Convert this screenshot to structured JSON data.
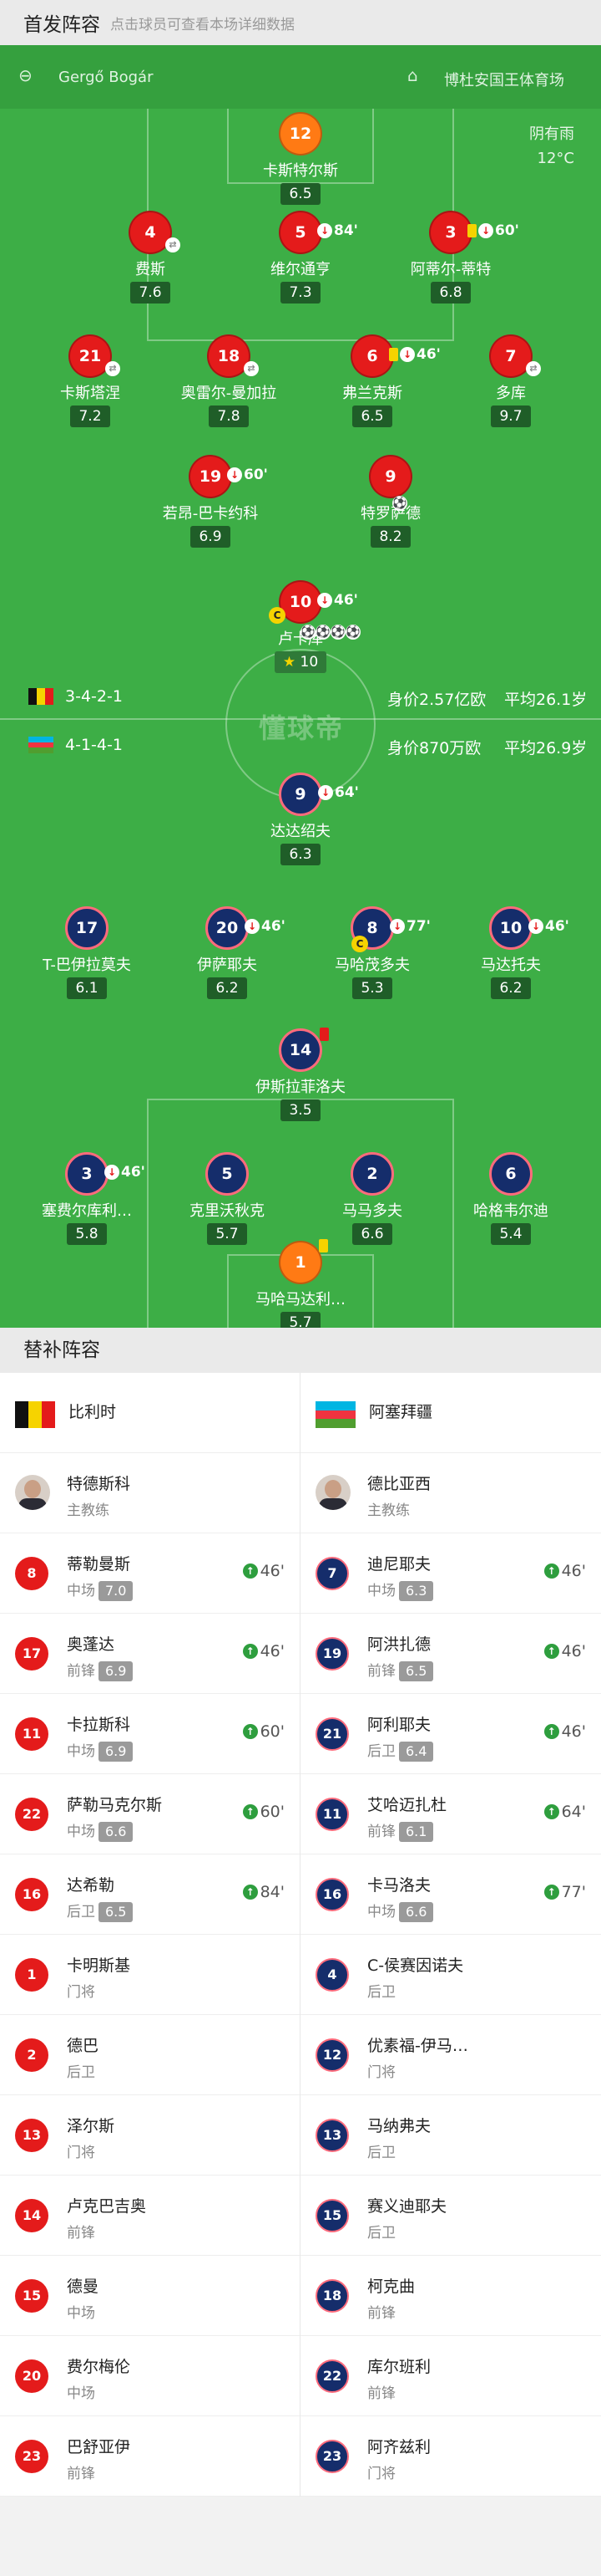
{
  "header": {
    "title": "首发阵容",
    "subtitle": "点击球员可查看本场详细数据"
  },
  "pitch": {
    "referee": "Gergő Bogár",
    "stadium": "博杜安国王体育场",
    "weather": "阴有雨",
    "temperature": "12°C",
    "watermark": "懂球帝",
    "colors": {
      "pitch": "#3dae46",
      "red": "#e41b1b",
      "navy": "#152d6b"
    }
  },
  "home": {
    "name": "比利时",
    "formation": "3-4-2-1",
    "value": "身价2.57亿欧",
    "avg_age": "平均26.1岁",
    "players": [
      {
        "num": "12",
        "name": "卡斯特尔斯",
        "rating": "6.5",
        "color": "org"
      },
      {
        "num": "4",
        "name": "费斯",
        "rating": "7.6",
        "color": "red"
      },
      {
        "num": "5",
        "name": "维尔通亨",
        "rating": "7.3",
        "color": "red",
        "sub": "84'"
      },
      {
        "num": "3",
        "name": "阿蒂尔-蒂特",
        "rating": "6.8",
        "color": "red",
        "sub": "60'"
      },
      {
        "num": "21",
        "name": "卡斯塔涅",
        "rating": "7.2",
        "color": "red"
      },
      {
        "num": "18",
        "name": "奥雷尔-曼加拉",
        "rating": "7.8",
        "color": "red"
      },
      {
        "num": "6",
        "name": "弗兰克斯",
        "rating": "6.5",
        "color": "red",
        "sub": "46'"
      },
      {
        "num": "7",
        "name": "多库",
        "rating": "9.7",
        "color": "red"
      },
      {
        "num": "19",
        "name": "若昂-巴卡约科",
        "rating": "6.9",
        "color": "red",
        "sub": "60'"
      },
      {
        "num": "9",
        "name": "特罗萨德",
        "rating": "8.2",
        "color": "red"
      },
      {
        "num": "10",
        "name": "卢卡库",
        "rating": "10",
        "color": "red",
        "sub": "46'"
      }
    ]
  },
  "away": {
    "name": "阿塞拜疆",
    "formation": "4-1-4-1",
    "value": "身价870万欧",
    "avg_age": "平均26.9岁",
    "players": [
      {
        "num": "9",
        "name": "达达绍夫",
        "rating": "6.3",
        "sub": "64'"
      },
      {
        "num": "17",
        "name": "T-巴伊拉莫夫",
        "rating": "6.1"
      },
      {
        "num": "20",
        "name": "伊萨耶夫",
        "rating": "6.2",
        "sub": "46'"
      },
      {
        "num": "8",
        "name": "马哈茂多夫",
        "rating": "5.3",
        "sub": "77'"
      },
      {
        "num": "10",
        "name": "马达托夫",
        "rating": "6.2",
        "sub": "46'"
      },
      {
        "num": "14",
        "name": "伊斯拉菲洛夫",
        "rating": "3.5"
      },
      {
        "num": "3",
        "name": "塞费尔库利…",
        "rating": "5.8",
        "sub": "46'"
      },
      {
        "num": "5",
        "name": "克里沃秋克",
        "rating": "5.7"
      },
      {
        "num": "2",
        "name": "马马多夫",
        "rating": "6.6"
      },
      {
        "num": "6",
        "name": "哈格韦尔迪",
        "rating": "5.4"
      },
      {
        "num": "1",
        "name": "马哈马达利…",
        "rating": "5.7"
      }
    ]
  },
  "subs": {
    "title": "替补阵容",
    "home": [
      {
        "num": "",
        "name": "特德斯科",
        "pos": "主教练",
        "coach": true
      },
      {
        "num": "8",
        "name": "蒂勒曼斯",
        "pos": "中场",
        "rating": "7.0",
        "in": "46'"
      },
      {
        "num": "17",
        "name": "奥蓬达",
        "pos": "前锋",
        "rating": "6.9",
        "in": "46'"
      },
      {
        "num": "11",
        "name": "卡拉斯科",
        "pos": "中场",
        "rating": "6.9",
        "in": "60'"
      },
      {
        "num": "22",
        "name": "萨勒马克尔斯",
        "pos": "中场",
        "rating": "6.6",
        "in": "60'"
      },
      {
        "num": "16",
        "name": "达希勒",
        "pos": "后卫",
        "rating": "6.5",
        "in": "84'"
      },
      {
        "num": "1",
        "name": "卡明斯基",
        "pos": "门将"
      },
      {
        "num": "2",
        "name": "德巴",
        "pos": "后卫"
      },
      {
        "num": "13",
        "name": "泽尔斯",
        "pos": "门将"
      },
      {
        "num": "14",
        "name": "卢克巴吉奥",
        "pos": "前锋"
      },
      {
        "num": "15",
        "name": "德曼",
        "pos": "中场"
      },
      {
        "num": "20",
        "name": "费尔梅伦",
        "pos": "中场"
      },
      {
        "num": "23",
        "name": "巴舒亚伊",
        "pos": "前锋"
      }
    ],
    "away": [
      {
        "num": "",
        "name": "德比亚西",
        "pos": "主教练",
        "coach": true
      },
      {
        "num": "7",
        "name": "迪尼耶夫",
        "pos": "中场",
        "rating": "6.3",
        "in": "46'"
      },
      {
        "num": "19",
        "name": "阿洪扎德",
        "pos": "前锋",
        "rating": "6.5",
        "in": "46'"
      },
      {
        "num": "21",
        "name": "阿利耶夫",
        "pos": "后卫",
        "rating": "6.4",
        "in": "46'"
      },
      {
        "num": "11",
        "name": "艾哈迈扎杜",
        "pos": "前锋",
        "rating": "6.1",
        "in": "64'"
      },
      {
        "num": "16",
        "name": "卡马洛夫",
        "pos": "中场",
        "rating": "6.6",
        "in": "77'"
      },
      {
        "num": "4",
        "name": "C-侯赛因诺夫",
        "pos": "后卫"
      },
      {
        "num": "12",
        "name": "优素福-伊马…",
        "pos": "门将"
      },
      {
        "num": "13",
        "name": "马纳弗夫",
        "pos": "后卫"
      },
      {
        "num": "15",
        "name": "赛义迪耶夫",
        "pos": "后卫"
      },
      {
        "num": "18",
        "name": "柯克曲",
        "pos": "前锋"
      },
      {
        "num": "22",
        "name": "库尔班利",
        "pos": "前锋"
      },
      {
        "num": "23",
        "name": "阿齐兹利",
        "pos": "门将"
      }
    ]
  }
}
